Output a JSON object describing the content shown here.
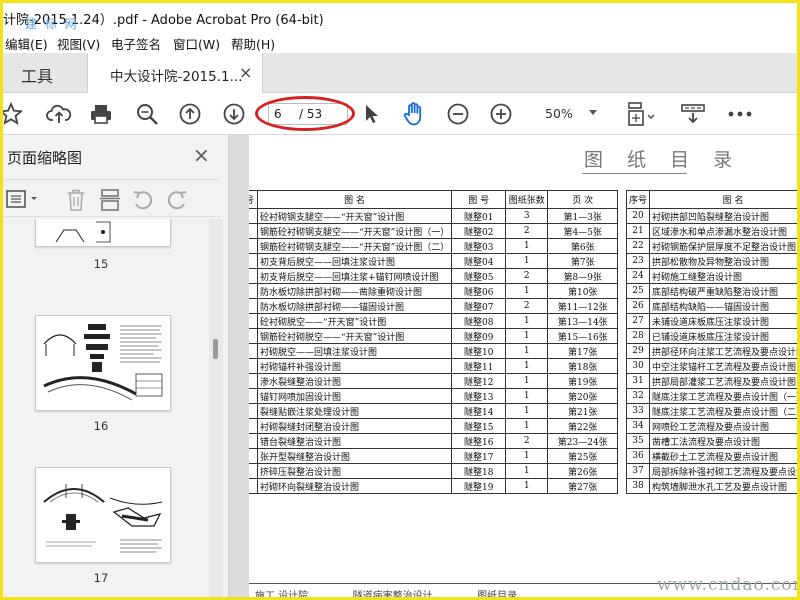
{
  "window": {
    "title": "计院-2015.1.24）.pdf - Adobe Acrobat Pro (64-bit)",
    "watermark": "建 标 网"
  },
  "menu": [
    "编辑(E)",
    "视图(V)",
    "电子签名",
    "窗口(W)",
    "帮助(H)"
  ],
  "tabs": {
    "tools": "工具",
    "document": "中大设计院-2015.1...",
    "close": "×"
  },
  "toolbar": {
    "current_page": "6",
    "total_pages": "/ 53",
    "zoom": "50%"
  },
  "sidebar": {
    "title": "页面缩略图",
    "close": "×",
    "thumbnails": [
      {
        "label": "15"
      },
      {
        "label": "16"
      },
      {
        "label": "17"
      }
    ]
  },
  "document": {
    "title": "图 纸 目 录",
    "left_headers": [
      "号",
      "图    名",
      "图  号",
      "图纸张数",
      "页  次"
    ],
    "left_rows": [
      [
        "",
        "砼衬砌钢支腿空——“开天窗”设计图",
        "隧整01",
        "3",
        "第1—3张"
      ],
      [
        "",
        "钢筋砼衬砌钢支腿空——“开天窗”设计图（一）",
        "隧整02",
        "2",
        "第4—5张"
      ],
      [
        "",
        "钢筋砼衬砌钢支腿空——“开天窗”设计图（二）",
        "隧整03",
        "1",
        "第6张"
      ],
      [
        "",
        "初支背后脱空——回填注浆设计图",
        "隧整04",
        "1",
        "第7张"
      ],
      [
        "",
        "初支背后脱空——回填注浆+锚钉网喷设计图",
        "隧整05",
        "2",
        "第8—9张"
      ],
      [
        "",
        "防水板切除拱部衬砌——凿除重砌设计图",
        "隧整06",
        "1",
        "第10张"
      ],
      [
        "",
        "防水板切除拱部衬砌——锚固设计图",
        "隧整07",
        "2",
        "第11—12张"
      ],
      [
        "",
        "砼衬砌脱空——“开天窗”设计图",
        "隧整08",
        "1",
        "第13—14张"
      ],
      [
        "",
        "钢筋砼衬砌脱空——“开天窗”设计图",
        "隧整09",
        "1",
        "第15—16张"
      ],
      [
        "",
        "衬砌脱空——回填注浆设计图",
        "隧整10",
        "1",
        "第17张"
      ],
      [
        "",
        "衬砌锚杆补强设计图",
        "隧整11",
        "1",
        "第18张"
      ],
      [
        "",
        "渗水裂缝整治设计图",
        "隧整12",
        "1",
        "第19张"
      ],
      [
        "",
        "锚钉网喷加固设计图",
        "隧整13",
        "1",
        "第20张"
      ],
      [
        "",
        "裂缝贴嵌注浆处理设计图",
        "隧整14",
        "1",
        "第21张"
      ],
      [
        "",
        "衬砌裂缝封闭整治设计图",
        "隧整15",
        "1",
        "第22张"
      ],
      [
        "",
        "错台裂缝整治设计图",
        "隧整16",
        "2",
        "第23—24张"
      ],
      [
        "",
        "张开型裂缝整治设计图",
        "隧整17",
        "1",
        "第25张"
      ],
      [
        "",
        "挤碎压裂整治设计图",
        "隧整18",
        "1",
        "第26张"
      ],
      [
        "",
        "衬砌环向裂缝整治设计图",
        "隧整19",
        "1",
        "第27张"
      ]
    ],
    "right_headers": [
      "序号",
      "图    名"
    ],
    "right_rows": [
      [
        "20",
        "衬砌拱部凹陷裂缝整治设计图"
      ],
      [
        "21",
        "区域渗水和单点渗漏水整治设计图"
      ],
      [
        "22",
        "衬砌钢筋保护层厚度不足整治设计图"
      ],
      [
        "23",
        "拱部松散物及异物整治设计图"
      ],
      [
        "24",
        "衬砌施工缝整治设计图"
      ],
      [
        "25",
        "底部结构破严重缺陷整治设计图"
      ],
      [
        "26",
        "底部结构缺陷——锚固设计图"
      ],
      [
        "27",
        "未铺设道床板底压注浆设计图"
      ],
      [
        "28",
        "已铺设道床板底压注浆设计图"
      ],
      [
        "29",
        "拱部径环向注浆工艺流程及要点设计图"
      ],
      [
        "30",
        "中空注浆锚杆工艺流程及要点设计图"
      ],
      [
        "31",
        "拱部局部灌浆工艺流程及要点设计图"
      ],
      [
        "32",
        "隧底注浆工艺流程及要点设计图（一）"
      ],
      [
        "33",
        "隧底注浆工艺流程及要点设计图（二）"
      ],
      [
        "34",
        "网喷砼工艺流程及要点设计图"
      ],
      [
        "35",
        "凿槽工法流程及要点设计图"
      ],
      [
        "36",
        "横截砂土工艺流程及要点设计图"
      ],
      [
        "37",
        "局部拆除补强衬砌工艺流程及要点设计图"
      ],
      [
        "38",
        "构筑墙脚泄水孔工艺及要点设计图"
      ]
    ],
    "bottom_strip": "施工 设计院              隧道病害整治设计              图纸目录",
    "watermark": "www.cndao.com"
  }
}
